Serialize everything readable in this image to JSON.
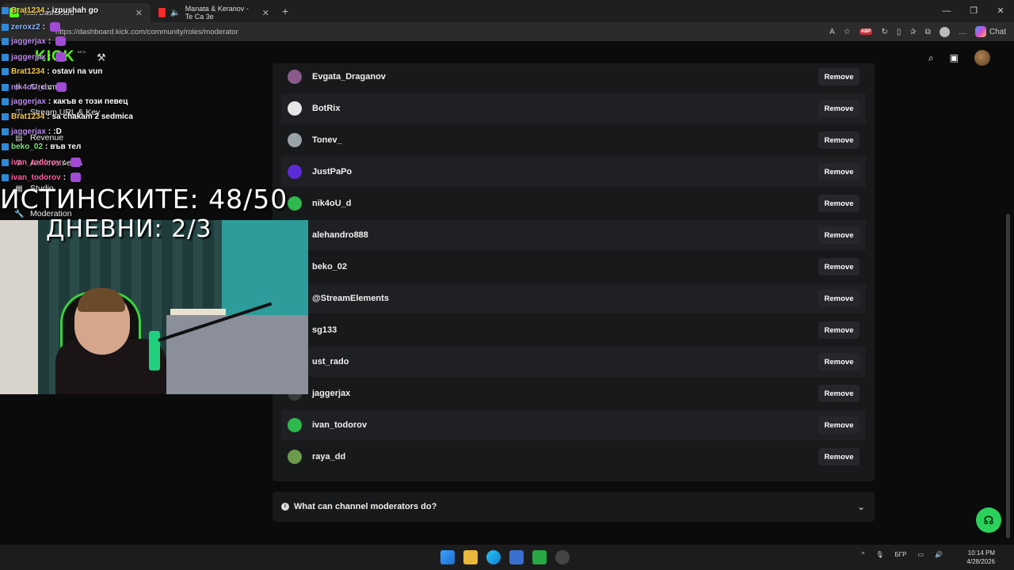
{
  "browser": {
    "tabs": [
      {
        "label": "Kick Dashboard",
        "active": true
      },
      {
        "label": "Manata & Keranov - Te Ca 3e",
        "active": false
      }
    ],
    "url": "https://dashboard.kick.com/community/roles/moderator",
    "chat_button": "Chat"
  },
  "header": {
    "logo": "KICK",
    "beta": "BETA"
  },
  "sidebar": {
    "items": [
      {
        "label": "Stream",
        "icon": "stream-icon"
      },
      {
        "label": "Stream URL & Key",
        "icon": "key-icon"
      },
      {
        "label": "Revenue",
        "icon": "revenue-icon"
      },
      {
        "label": "Achievements",
        "icon": "trophy-icon"
      },
      {
        "label": "Studio",
        "icon": "studio-icon"
      },
      {
        "label": "Moderation",
        "icon": "wrench-icon"
      }
    ]
  },
  "moderators": [
    {
      "name": "Evgata_Draganov",
      "avatar_color": "#8a5a8c"
    },
    {
      "name": "BotRix",
      "avatar_color": "#e6e6e6"
    },
    {
      "name": "Tonev_",
      "avatar_color": "#9aa3a8"
    },
    {
      "name": "JustPaPo",
      "avatar_color": "#5b2bd6"
    },
    {
      "name": "nik4oU_d",
      "avatar_color": "#2fb84c"
    },
    {
      "name": "alehandro888",
      "avatar_color": "#3a3a3a"
    },
    {
      "name": "beko_02",
      "avatar_color": "#3a3a3a"
    },
    {
      "name": "@StreamElements",
      "avatar_color": "#3a3a3a"
    },
    {
      "name": "sg133",
      "avatar_color": "#3a3a3a"
    },
    {
      "name": "ust_rado",
      "avatar_color": "#3a3a3a"
    },
    {
      "name": "jaggerjax",
      "avatar_color": "#3a3a3a"
    },
    {
      "name": "ivan_todorov",
      "avatar_color": "#2fb84c"
    },
    {
      "name": "raya_dd",
      "avatar_color": "#6a9a4a"
    }
  ],
  "remove_label": "Remove",
  "faq": {
    "label": "What can channel moderators do?"
  },
  "overlay": {
    "chat": [
      {
        "user": "Brat1234",
        "color": "#f3c94a",
        "msg": "izpushah go"
      },
      {
        "user": "zeroxz2",
        "color": "#8fb8ff",
        "msg": ""
      },
      {
        "user": "jaggerjax",
        "color": "#b88ae6",
        "msg": ""
      },
      {
        "user": "jaggerjax",
        "color": "#b88ae6",
        "msg": ""
      },
      {
        "user": "Brat1234",
        "color": "#f3c94a",
        "msg": "ostavi na vun"
      },
      {
        "user": "nik4oU_d",
        "color": "#b88ae6",
        "msg": ""
      },
      {
        "user": "jaggerjax",
        "color": "#b88ae6",
        "msg": "какъв е този певец"
      },
      {
        "user": "Brat1234",
        "color": "#f3c94a",
        "msg": "sa chakam 2 sedmica"
      },
      {
        "user": "jaggerjax",
        "color": "#b88ae6",
        "msg": ":D"
      },
      {
        "user": "beko_02",
        "color": "#7ee07e",
        "msg": "във тел"
      },
      {
        "user": "ivan_todorov",
        "color": "#ff5fa0",
        "msg": ""
      },
      {
        "user": "ivan_todorov",
        "color": "#ff5fa0",
        "msg": ""
      }
    ],
    "counter_main": "ИСТИНСКИТЕ: 48/50",
    "counter_daily": "ДНЕВНИ: 2/3"
  },
  "taskbar": {
    "lang": "БГР",
    "time": "10:14 PM",
    "date": "4/28/2026"
  }
}
